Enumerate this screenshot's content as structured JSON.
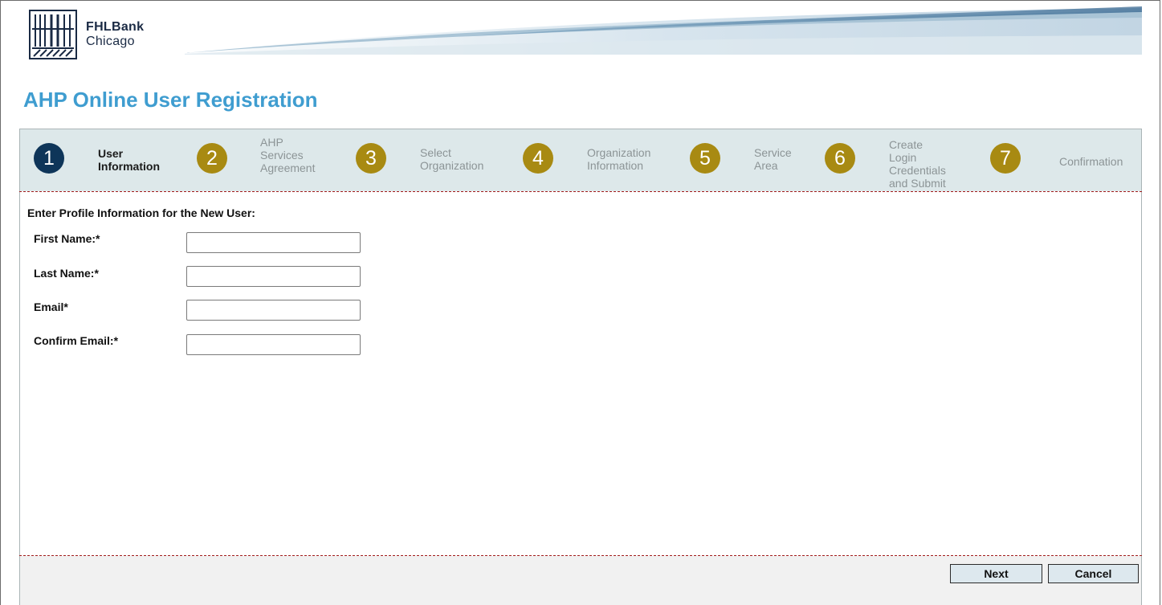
{
  "brand": {
    "name_line1": "FHLBank",
    "name_line2": "Chicago"
  },
  "page": {
    "title": "AHP Online User Registration"
  },
  "steps": [
    {
      "number": "1",
      "label": [
        "User",
        "Information"
      ],
      "active": true,
      "color": "#0e3559"
    },
    {
      "number": "2",
      "label": [
        "AHP",
        "Services",
        "Agreement"
      ],
      "active": false,
      "color": "#a88a12"
    },
    {
      "number": "3",
      "label": [
        "Select",
        "Organization"
      ],
      "active": false,
      "color": "#a88a12"
    },
    {
      "number": "4",
      "label": [
        "Organization",
        "Information"
      ],
      "active": false,
      "color": "#a88a12"
    },
    {
      "number": "5",
      "label": [
        "Service",
        "Area"
      ],
      "active": false,
      "color": "#a88a12"
    },
    {
      "number": "6",
      "label": [
        "Create Login",
        "Credentials",
        "and Submit"
      ],
      "active": false,
      "color": "#a88a12"
    },
    {
      "number": "7",
      "label": [
        "Confirmation"
      ],
      "active": false,
      "color": "#a88a12"
    }
  ],
  "form": {
    "heading": "Enter Profile Information for the New User:",
    "fields": [
      {
        "label": "First Name:*",
        "value": ""
      },
      {
        "label": "Last Name:*",
        "value": ""
      },
      {
        "label": "Email*",
        "value": ""
      },
      {
        "label": "Confirm Email:*",
        "value": ""
      }
    ]
  },
  "buttons": {
    "next": "Next",
    "cancel": "Cancel"
  },
  "colors": {
    "title": "#3f9dd0",
    "active_step": "#0e3559",
    "inactive_step": "#a88a12",
    "divider": "#a11d1d"
  }
}
